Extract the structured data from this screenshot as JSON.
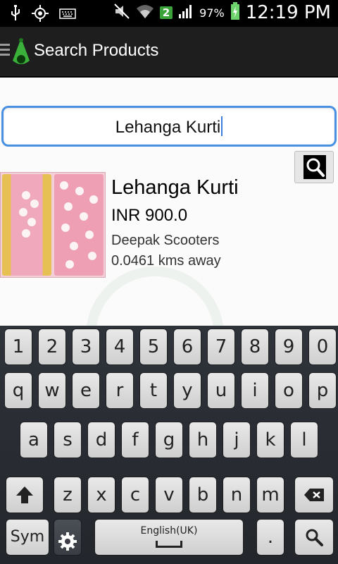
{
  "status_bar": {
    "time": "12:19 PM",
    "battery_percent": "97%",
    "sim_badge": "2",
    "icons": [
      "usb-icon",
      "gps-icon",
      "keyboard-icon",
      "mute-icon",
      "wifi-icon",
      "signal-icon",
      "battery-icon"
    ]
  },
  "action_bar": {
    "title": "Search Products",
    "icons": [
      "menu-icon",
      "app-logo-icon"
    ]
  },
  "search": {
    "value": "Lehanga Kurti",
    "button_icon": "search-icon"
  },
  "results": [
    {
      "name": "Lehanga Kurti",
      "price": "INR 900.0",
      "seller": "Deepak Scooters",
      "distance": "0.0461 kms away"
    }
  ],
  "keyboard": {
    "row_numbers": [
      "1",
      "2",
      "3",
      "4",
      "5",
      "6",
      "7",
      "8",
      "9",
      "0"
    ],
    "row_1": [
      "q",
      "w",
      "e",
      "r",
      "t",
      "y",
      "u",
      "i",
      "o",
      "p"
    ],
    "row_2": [
      "a",
      "s",
      "d",
      "f",
      "g",
      "h",
      "j",
      "k",
      "l"
    ],
    "row_3": [
      "z",
      "x",
      "c",
      "v",
      "b",
      "n",
      "m"
    ],
    "sym_label": "Sym",
    "language_label": "English(UK)",
    "period_label": ".",
    "colors": {
      "dark_key": "#3a3d43",
      "light_key": "#cfcfcf",
      "accent": "#4a90e2"
    }
  }
}
